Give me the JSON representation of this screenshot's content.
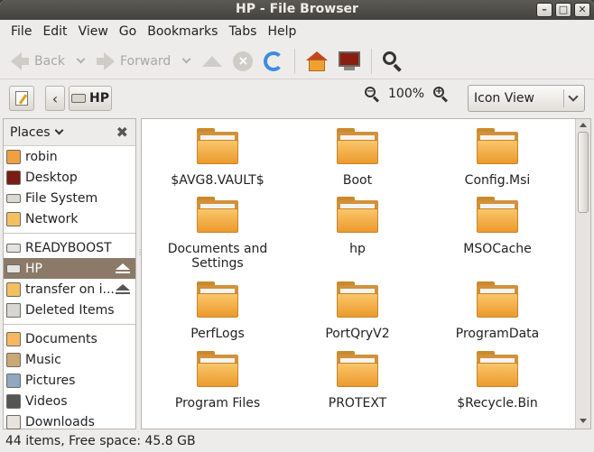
{
  "window": {
    "title": "HP - File Browser",
    "minimize": "–",
    "maximize": "□",
    "close": "✕"
  },
  "menu": [
    "File",
    "Edit",
    "View",
    "Go",
    "Bookmarks",
    "Tabs",
    "Help"
  ],
  "toolbar": {
    "back_label": "Back",
    "forward_label": "Forward"
  },
  "location": {
    "back_arrow": "‹",
    "current": "HP"
  },
  "zoom": {
    "level": "100%",
    "out": "−",
    "in": "+"
  },
  "view_mode": "Icon View",
  "sidebar": {
    "header": "Places",
    "close": "✖",
    "groups": [
      [
        {
          "label": "robin",
          "icon": "home"
        },
        {
          "label": "Desktop",
          "icon": "desktop"
        },
        {
          "label": "File System",
          "icon": "fs"
        },
        {
          "label": "Network",
          "icon": "net"
        }
      ],
      [
        {
          "label": "READYBOOST",
          "icon": "drive"
        },
        {
          "label": "HP",
          "icon": "drive",
          "selected": true,
          "eject": true
        },
        {
          "label": "transfer on i...",
          "icon": "net",
          "eject": true
        },
        {
          "label": "Deleted Items",
          "icon": "trash"
        }
      ],
      [
        {
          "label": "Documents",
          "icon": "folder"
        },
        {
          "label": "Music",
          "icon": "music"
        },
        {
          "label": "Pictures",
          "icon": "pictures"
        },
        {
          "label": "Videos",
          "icon": "videos"
        },
        {
          "label": "Downloads",
          "icon": "downloads"
        }
      ]
    ]
  },
  "files": [
    "$AVG8.VAULT$",
    "Boot",
    "Config.Msi",
    "Documents and Settings",
    "hp",
    "MSOCache",
    "PerfLogs",
    "PortQryV2",
    "ProgramData",
    "Program Files",
    "PROTEXT",
    "$Recycle.Bin"
  ],
  "status": "44 items, Free space: 45.8 GB"
}
